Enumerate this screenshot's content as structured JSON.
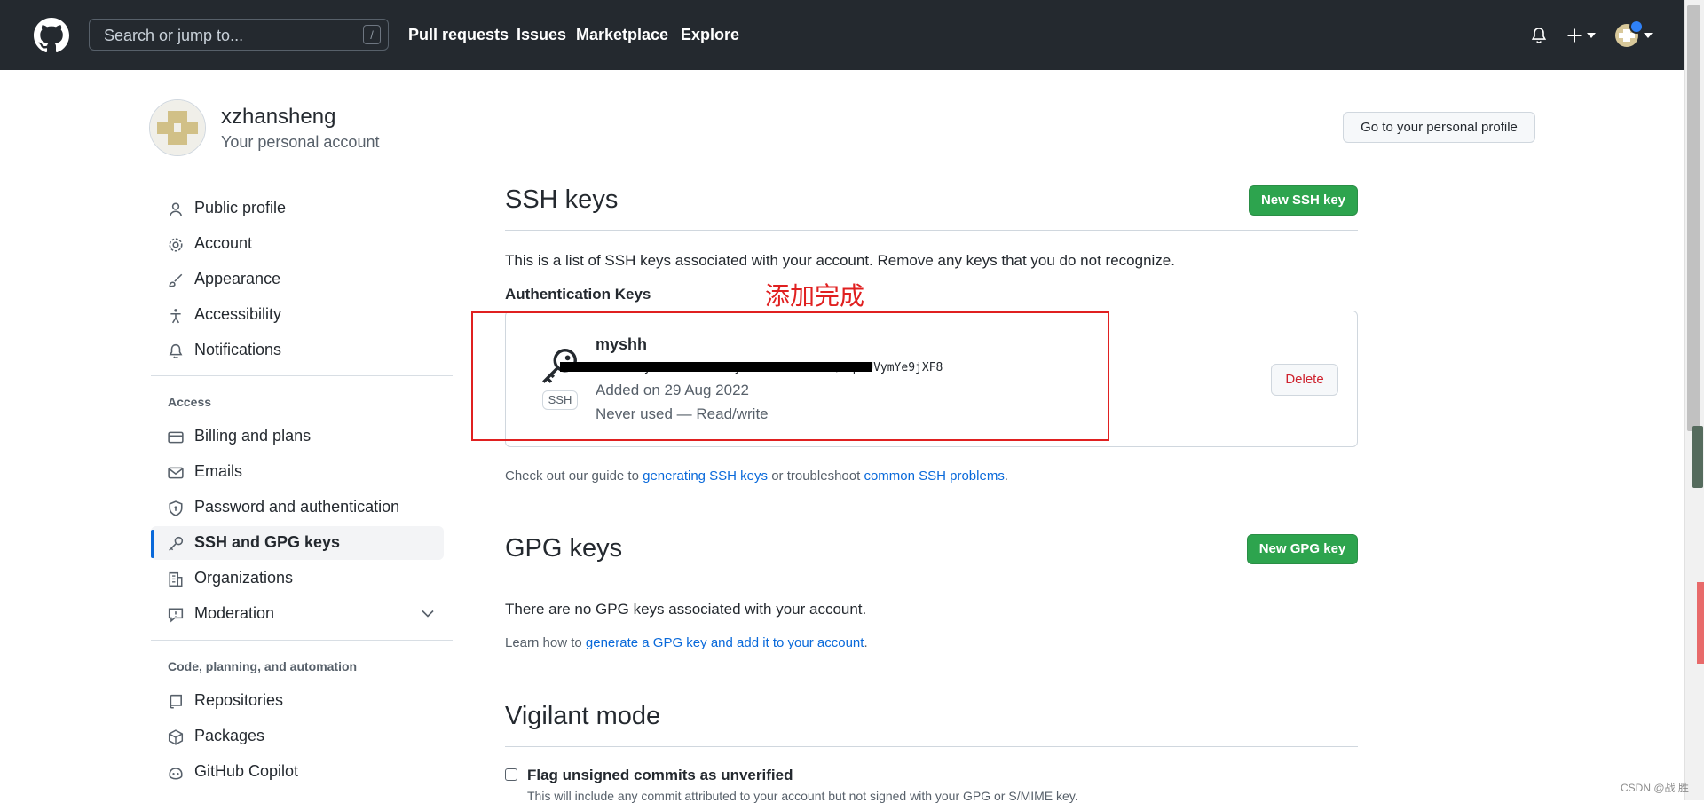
{
  "header": {
    "search_placeholder": "Search or jump to...",
    "search_shortcut": "/",
    "nav": [
      "Pull requests",
      "Issues",
      "Marketplace",
      "Explore"
    ],
    "icons": [
      "github-logo",
      "bell-icon",
      "plus-icon",
      "chevron-down-icon",
      "user-avatar"
    ]
  },
  "profile": {
    "username": "xzhansheng",
    "account_type": "Your personal account",
    "profile_button": "Go to your personal profile"
  },
  "sidebar": {
    "items_top": [
      {
        "label": "Public profile",
        "icon": "person-icon"
      },
      {
        "label": "Account",
        "icon": "gear-icon"
      },
      {
        "label": "Appearance",
        "icon": "paintbrush-icon"
      },
      {
        "label": "Accessibility",
        "icon": "accessibility-icon"
      },
      {
        "label": "Notifications",
        "icon": "bell-icon"
      }
    ],
    "access_heading": "Access",
    "items_access": [
      {
        "label": "Billing and plans",
        "icon": "credit-card-icon"
      },
      {
        "label": "Emails",
        "icon": "mail-icon"
      },
      {
        "label": "Password and authentication",
        "icon": "shield-icon"
      },
      {
        "label": "SSH and GPG keys",
        "icon": "key-icon",
        "active": true
      },
      {
        "label": "Organizations",
        "icon": "organization-icon"
      },
      {
        "label": "Moderation",
        "icon": "report-icon"
      }
    ],
    "code_heading": "Code, planning, and automation",
    "items_code": [
      {
        "label": "Repositories",
        "icon": "repo-icon"
      },
      {
        "label": "Packages",
        "icon": "package-icon"
      },
      {
        "label": "GitHub Copilot",
        "icon": "copilot-icon"
      }
    ]
  },
  "ssh": {
    "title": "SSH keys",
    "new_button": "New SSH key",
    "description": "This is a list of SSH keys associated with your account. Remove any keys that you do not recognize.",
    "auth_heading": "Authentication Keys",
    "annotation": "添加完成",
    "key": {
      "title": "myshh",
      "badge": "SSH",
      "fingerprint": "SHA256:y1 b3ohzkxIFTyv1UrkKoUrTktrQTmpHUVymYe9jXF8",
      "added": "Added on 29 Aug 2022",
      "usage": "Never used — Read/write",
      "delete_label": "Delete"
    },
    "guide_prefix": "Check out our guide to ",
    "guide_link1": "generating SSH keys",
    "guide_middle": " or troubleshoot ",
    "guide_link2": "common SSH problems",
    "guide_suffix": "."
  },
  "gpg": {
    "title": "GPG keys",
    "new_button": "New GPG key",
    "empty_text": "There are no GPG keys associated with your account.",
    "learn_prefix": "Learn how to ",
    "learn_link": "generate a GPG key and add it to your account",
    "learn_suffix": "."
  },
  "vigilant": {
    "title": "Vigilant mode",
    "checkbox_label": "Flag unsigned commits as unverified",
    "checkbox_checked": false,
    "description": "This will include any commit attributed to your account but not signed with your GPG or S/MIME key."
  },
  "watermark": "CSDN @战 胜",
  "colors": {
    "header_bg": "#24292f",
    "primary_green": "#2da44e",
    "link_blue": "#0969da",
    "active_indicator": "#0969da",
    "danger_red": "#cf222e",
    "annotation_red": "#e02020"
  }
}
